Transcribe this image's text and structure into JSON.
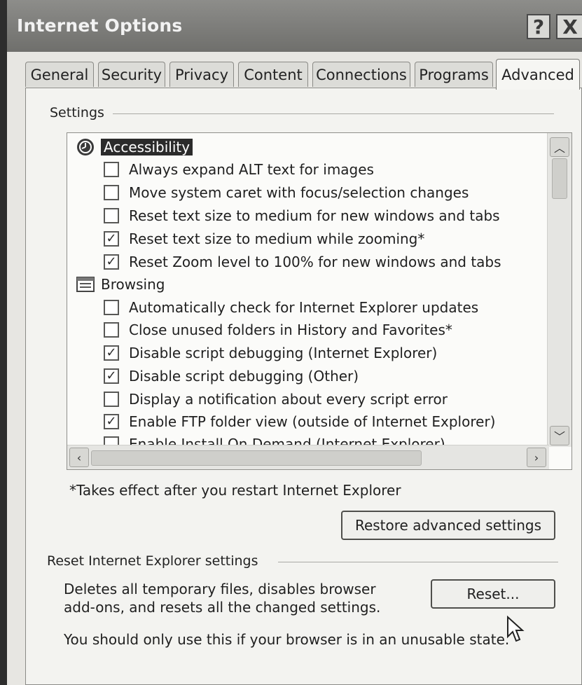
{
  "window": {
    "title": "Internet Options",
    "help_label": "?",
    "close_label": "X"
  },
  "tabs": [
    {
      "label": "General"
    },
    {
      "label": "Security"
    },
    {
      "label": "Privacy"
    },
    {
      "label": "Content"
    },
    {
      "label": "Connections"
    },
    {
      "label": "Programs"
    },
    {
      "label": "Advanced",
      "active": true
    }
  ],
  "settings": {
    "group_label": "Settings",
    "categories": [
      {
        "label": "Accessibility",
        "icon": "accessibility-icon",
        "selected": true,
        "items": [
          {
            "label": "Always expand ALT text for images",
            "checked": false
          },
          {
            "label": "Move system caret with focus/selection changes",
            "checked": false
          },
          {
            "label": "Reset text size to medium for new windows and tabs",
            "checked": false
          },
          {
            "label": "Reset text size to medium while zooming*",
            "checked": true
          },
          {
            "label": "Reset Zoom level to 100% for new windows and tabs",
            "checked": true
          }
        ]
      },
      {
        "label": "Browsing",
        "icon": "browsing-icon",
        "selected": false,
        "items": [
          {
            "label": "Automatically check for Internet Explorer updates",
            "checked": false
          },
          {
            "label": "Close unused folders in History and Favorites*",
            "checked": false
          },
          {
            "label": "Disable script debugging (Internet Explorer)",
            "checked": true
          },
          {
            "label": "Disable script debugging (Other)",
            "checked": true
          },
          {
            "label": "Display a notification about every script error",
            "checked": false
          },
          {
            "label": "Enable FTP folder view (outside of Internet Explorer)",
            "checked": true
          },
          {
            "label": "Enable Install On Demand (Internet Explorer)",
            "checked": false
          }
        ]
      }
    ],
    "note": "*Takes effect after you restart Internet Explorer",
    "restore_button": "Restore advanced settings"
  },
  "reset_section": {
    "group_label": "Reset Internet Explorer settings",
    "description_line1": "Deletes all temporary files, disables browser",
    "description_line2": "add-ons, and resets all the changed settings.",
    "reset_button": "Reset...",
    "warning": "You should only use this if your browser is in an unusable state."
  },
  "colors": {
    "titlebar": "#7a7a77",
    "selection": "#2b2b2b",
    "panel": "#f3f3f0"
  }
}
